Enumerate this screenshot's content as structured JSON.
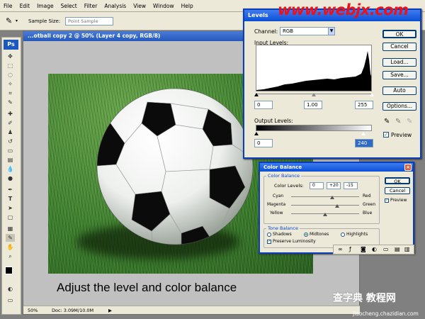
{
  "menu": [
    "File",
    "Edit",
    "Image",
    "Select",
    "Filter",
    "Analysis",
    "View",
    "Window",
    "Help"
  ],
  "options": {
    "sample_label": "Sample Size:",
    "sample_value": "Point Sample"
  },
  "toolbox": {
    "logo": "Ps"
  },
  "document": {
    "title": "...otball copy 2 @ 50% (Layer 4 copy, RGB/8)",
    "status": "Doc: 3.09M/10.0M"
  },
  "caption": "Adjust the level and color balance",
  "levels": {
    "title": "Levels",
    "channel_label": "Channel:",
    "channel_value": "RGB",
    "input_label": "Input Levels:",
    "input_black": "0",
    "input_gamma": "1.00",
    "input_white": "255",
    "output_label": "Output Levels:",
    "output_black": "0",
    "output_white": "240",
    "buttons": {
      "ok": "OK",
      "cancel": "Cancel",
      "load": "Load...",
      "save": "Save...",
      "auto": "Auto",
      "options": "Options..."
    },
    "preview_label": "Preview"
  },
  "color_balance": {
    "title": "Color Balance",
    "group_label": "Color Balance",
    "levels_label": "Color Levels:",
    "level1": "0",
    "level2": "+20",
    "level3": "-15",
    "rows": [
      {
        "left": "Cyan",
        "right": "Red"
      },
      {
        "left": "Magenta",
        "right": "Green"
      },
      {
        "left": "Yellow",
        "right": "Blue"
      }
    ],
    "slider_positions": [
      0.6,
      0.68,
      0.5
    ],
    "tone_label": "Tone Balance",
    "shadows": "Shadows",
    "midtones": "Midtones",
    "highlights": "Highlights",
    "preserve": "Preserve Luminosity",
    "buttons": {
      "ok": "OK",
      "cancel": "Cancel"
    },
    "preview_label": "Preview"
  },
  "watermarks": {
    "top": "www.webjx.com",
    "bottom_cn": "查字典 教程网",
    "bottom_url": "jiaocheng.chazidian.com"
  },
  "colors": {
    "accent": "#0a4fd6",
    "watermark": "#e8131c",
    "grass": "#3b7a2a"
  }
}
